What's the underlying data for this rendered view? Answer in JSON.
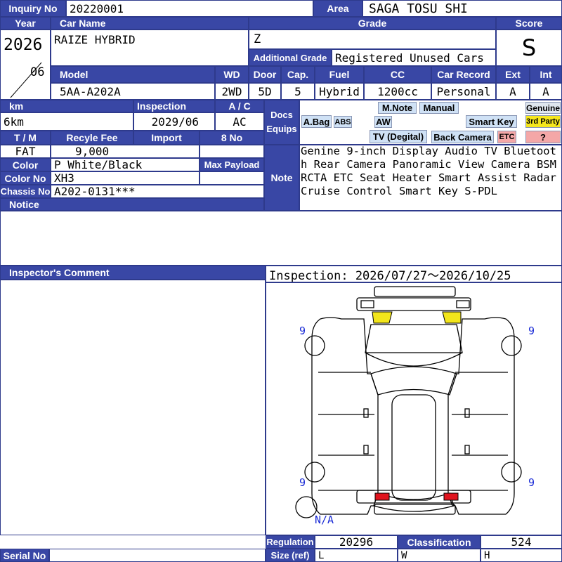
{
  "inquiry": {
    "label": "Inquiry No",
    "value": "20220001"
  },
  "area": {
    "label": "Area",
    "value": "SAGA TOSU SHI"
  },
  "year": {
    "label": "Year",
    "year": "2026",
    "month": "06"
  },
  "car_name": {
    "label": "Car Name",
    "value": "RAIZE HYBRID"
  },
  "grade": {
    "label": "Grade",
    "value": "Z"
  },
  "additional_grade": {
    "label": "Additional Grade",
    "value": "Registered Unused Cars"
  },
  "score": {
    "label": "Score",
    "value": "S"
  },
  "model": {
    "label": "Model",
    "value": "5AA-A202A"
  },
  "wd": {
    "label": "WD",
    "value": "2WD"
  },
  "door": {
    "label": "Door",
    "value": "5D"
  },
  "cap": {
    "label": "Cap.",
    "value": "5"
  },
  "fuel": {
    "label": "Fuel",
    "value": "Hybrid"
  },
  "cc": {
    "label": "CC",
    "value": "1200cc"
  },
  "car_record": {
    "label": "Car Record",
    "value": "Personal"
  },
  "ext": {
    "label": "Ext",
    "value": "A"
  },
  "int": {
    "label": "Int",
    "value": "A"
  },
  "km": {
    "label": "km",
    "value": "6km"
  },
  "inspection": {
    "label": "Inspection",
    "value": "2029/06"
  },
  "ac": {
    "label": "A / C",
    "value": "AC"
  },
  "docs": {
    "label_line1": "Docs",
    "label_line2": "Equips"
  },
  "equips": {
    "abag": "A.Bag",
    "abs": "ABS",
    "mnote": "M.Note",
    "manual": "Manual",
    "aw": "AW",
    "smart_key": "Smart Key",
    "tv": "TV (Degital)",
    "back_camera": "Back Camera",
    "etc": "ETC",
    "genuine": "Genuine",
    "third_party": "3rd Party",
    "unknown": "?"
  },
  "tm": {
    "label": "T / M",
    "value": "FAT"
  },
  "recycle_fee": {
    "label": "Recyle Fee",
    "value": "9,000"
  },
  "import": {
    "label": "Import",
    "value": ""
  },
  "eight_no": {
    "label": "8 No",
    "value": ""
  },
  "color": {
    "label": "Color",
    "value": "P White/Black"
  },
  "max_payload": {
    "label": "Max Payload",
    "value": ""
  },
  "color_no": {
    "label": "Color No",
    "value": "XH3"
  },
  "chassis_no": {
    "label": "Chassis No",
    "value": "A202-0131***"
  },
  "notice": {
    "label": "Notice",
    "value": ""
  },
  "note": {
    "label": "Note",
    "value": "Genine 9-inch Display Audio TV Bluetooth Rear Camera Panoramic View Camera BSM RCTA ETC Seat Heater Smart Assist Radar Cruise Control Smart Key S-PDL"
  },
  "inspector_comment": {
    "label": "Inspector's Comment",
    "value": ""
  },
  "inspection_period": "Inspection: 2026/07/27〜2026/10/25",
  "diagram": {
    "tire_marks": [
      "9",
      "9",
      "9",
      "9"
    ],
    "spare": "N/A"
  },
  "regulation": {
    "label": "Regulation",
    "value": "20296"
  },
  "classification": {
    "label": "Classification",
    "value": "524"
  },
  "size": {
    "label": "Size (ref)",
    "l": "L",
    "w": "W",
    "h": "H"
  },
  "serial_no": {
    "label": "Serial No",
    "value": ""
  }
}
